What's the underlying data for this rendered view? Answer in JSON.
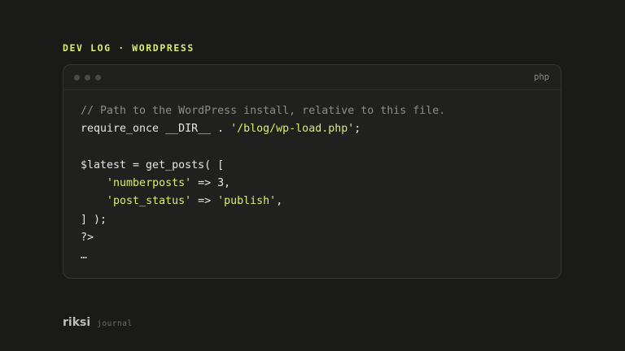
{
  "header": {
    "eyebrow": "DEV LOG · WORDPRESS"
  },
  "code_window": {
    "language": "php",
    "lines": [
      [
        {
          "t": "comment",
          "v": "// Path to the WordPress install, relative to this file."
        }
      ],
      [
        {
          "t": "plain",
          "v": "require_once __DIR__ . "
        },
        {
          "t": "string",
          "v": "'/blog/wp-load.php'"
        },
        {
          "t": "plain",
          "v": ";"
        }
      ],
      [],
      [
        {
          "t": "plain",
          "v": "$latest = get_posts( ["
        }
      ],
      [
        {
          "t": "plain",
          "v": "    "
        },
        {
          "t": "string",
          "v": "'numberposts'"
        },
        {
          "t": "plain",
          "v": " => 3,"
        }
      ],
      [
        {
          "t": "plain",
          "v": "    "
        },
        {
          "t": "string",
          "v": "'post_status'"
        },
        {
          "t": "plain",
          "v": " => "
        },
        {
          "t": "string",
          "v": "'publish'"
        },
        {
          "t": "plain",
          "v": ","
        }
      ],
      [
        {
          "t": "plain",
          "v": "] );"
        }
      ],
      [
        {
          "t": "plain",
          "v": "?>"
        }
      ],
      [
        {
          "t": "plain",
          "v": "…"
        }
      ]
    ]
  },
  "footer": {
    "brand": "riksi",
    "subtitle": "journal"
  },
  "colors": {
    "background": "#1a1a18",
    "card": "#20201e",
    "accent": "#d8f06a",
    "comment": "#8c8c86",
    "text": "#e6e6e1"
  },
  "icons": [
    "window-dot-icon",
    "window-dot-icon",
    "window-dot-icon"
  ]
}
